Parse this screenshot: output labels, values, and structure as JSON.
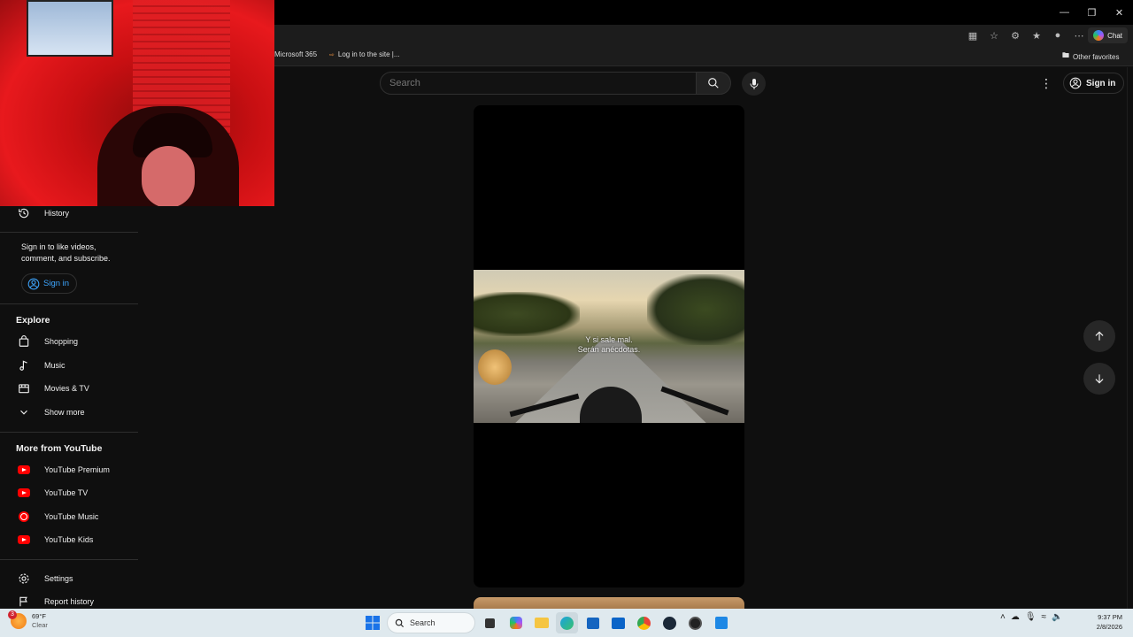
{
  "browser": {
    "chat_label": "Chat",
    "favorites": [
      {
        "label": "Microsoft 365"
      },
      {
        "label": "Log in to the site |..."
      }
    ],
    "other_favorites": "Other favorites"
  },
  "header": {
    "search_placeholder": "Search",
    "signin_label": "Sign in"
  },
  "sidebar": {
    "history_label": "History",
    "signin_prompt": "Sign in to like videos, comment, and subscribe.",
    "signin_label": "Sign in",
    "explore_heading": "Explore",
    "explore_items": [
      {
        "label": "Shopping",
        "icon": "shopping-bag-icon"
      },
      {
        "label": "Music",
        "icon": "music-note-icon"
      },
      {
        "label": "Movies & TV",
        "icon": "film-icon"
      },
      {
        "label": "Show more",
        "icon": "chevron-down-icon"
      }
    ],
    "more_heading": "More from YouTube",
    "more_items": [
      {
        "label": "YouTube Premium"
      },
      {
        "label": "YouTube TV"
      },
      {
        "label": "YouTube Music"
      },
      {
        "label": "YouTube Kids"
      }
    ],
    "settings_label": "Settings",
    "report_label": "Report history"
  },
  "video": {
    "caption_line1": "Y si sale mal.",
    "caption_line2": "Serán anécdotas."
  },
  "taskbar": {
    "weather_temp": "69°F",
    "weather_cond": "Clear",
    "weather_badge": "3",
    "search_label": "Search",
    "time": "9:37 PM",
    "date": "2/8/2026"
  },
  "colors": {
    "background": "#0f0f0f",
    "accent_link": "#3ea6ff",
    "youtube_red": "#ff0000",
    "taskbar": "#dfe9ee"
  }
}
